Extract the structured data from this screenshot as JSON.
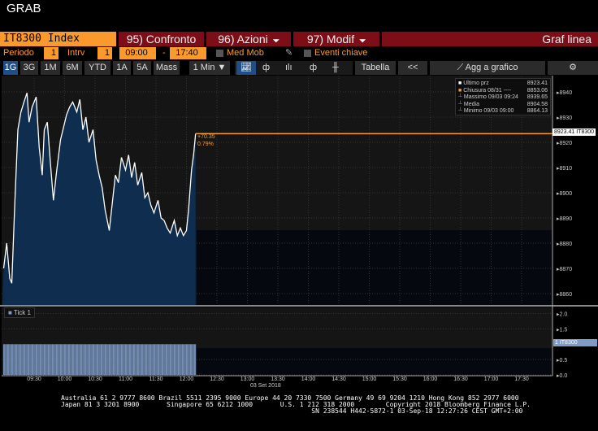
{
  "title": "GRAB",
  "toolbar": {
    "ticker": "IT8300 Index",
    "compare": "95) Confronto",
    "actions": "96) Azioni",
    "modify": "97) Modif",
    "chart_type": "Graf linea"
  },
  "settings": {
    "period_label": "Periodo",
    "period_value": "1",
    "interval_label": "Intrv",
    "interval_value": "1",
    "start_time": "09:00",
    "dash": "-",
    "end_time": "17:40",
    "moving_avg": "Med Mob",
    "key_events": "Eventi chiave"
  },
  "ranges": [
    "1G",
    "3G",
    "1M",
    "6M",
    "YTD",
    "1A",
    "5A",
    "Mass"
  ],
  "frequency": "1 Min ▼",
  "view_buttons": {
    "table": "Tabella",
    "collapse": "<<",
    "add_to_chart": "Agg a grafico"
  },
  "legend": [
    {
      "label": "Ultimo prz",
      "value": "8923.41"
    },
    {
      "label": "Chiusura 08/31 ----",
      "value": "8853.06"
    },
    {
      "label": "Massimo 09/03 09:24",
      "value": "8939.65"
    },
    {
      "label": "Media",
      "value": "8904.58"
    },
    {
      "label": "Minimo 09/03 09:00",
      "value": "8864.13"
    }
  ],
  "colors": {
    "accent": "#fb9a2c",
    "toolbar_red": "#7d0d17",
    "area": "#0e2d4f",
    "line": "#ffffff",
    "volume": "#7f9cc8"
  },
  "chart_data": {
    "type": "area",
    "title": "IT8300 Index",
    "date_label": "03 Set 2018",
    "price_ylim": [
      8857,
      8948
    ],
    "price_ticks": [
      8860,
      8870,
      8880,
      8890,
      8900,
      8910,
      8920,
      8930,
      8940
    ],
    "last_price_label": "8923.41 IT8300",
    "change_label": "+70.35",
    "change_pct_label": "0.79%",
    "x_minutes_from_0900": [
      0,
      3,
      6,
      8,
      11,
      14,
      17,
      20,
      23,
      25,
      28,
      32,
      35,
      38,
      40,
      43,
      46,
      49,
      52,
      56,
      59,
      62,
      65,
      68,
      72,
      75,
      78,
      81,
      84,
      88,
      91,
      94,
      97,
      100,
      104,
      107,
      110,
      113,
      116,
      120,
      123,
      126,
      129,
      132,
      136,
      139,
      142,
      145,
      148,
      152,
      155,
      158,
      161,
      164,
      168,
      171,
      174,
      177,
      180,
      182,
      185,
      187,
      189
    ],
    "values": [
      8870,
      8880,
      8866,
      8864.1,
      8896,
      8925,
      8932,
      8936,
      8939.6,
      8928,
      8934,
      8938,
      8918,
      8907,
      8925,
      8928,
      8912,
      8897,
      8908,
      8921,
      8926,
      8931,
      8934,
      8936,
      8932,
      8937,
      8925,
      8930,
      8920,
      8925,
      8913,
      8907,
      8902,
      8893,
      8885,
      8896,
      8907,
      8904,
      8914,
      8909,
      8915,
      8906,
      8912,
      8903,
      8908,
      8898,
      8900,
      8895,
      8892,
      8897,
      8890,
      8889,
      8886,
      8884,
      8889,
      8883,
      8886,
      8883,
      8885,
      8893,
      8909,
      8915,
      8923.41
    ],
    "x_ticks": [
      "09:30",
      "10:00",
      "10:30",
      "11:00",
      "11:30",
      "12:00",
      "12:30",
      "13:00",
      "13:30",
      "14:00",
      "14:30",
      "15:00",
      "15:30",
      "16:00",
      "16:30",
      "17:00",
      "17:30"
    ],
    "study": {
      "name": "Tick 1",
      "value": 1,
      "label": "1 IT8300",
      "ylim": [
        0,
        2.2
      ],
      "ticks": [
        "2.0",
        "1.5",
        "0.5",
        "0.0"
      ]
    }
  },
  "footer": {
    "line1": "Australia 61 2 9777 8600 Brazil 5511 2395 9000 Europe 44 20 7330 7500 Germany 49 69 9204 1210 Hong Kong 852 2977 6000",
    "line2": "Japan 81 3 3201 8900       Singapore 65 6212 1000       U.S. 1 212 318 2000        Copyright 2018 Bloomberg Finance L.P.",
    "line3": "                                                                SN 238544 H442-5872-1 03-Sep-18 12:27:26 CEST GMT+2:00"
  }
}
